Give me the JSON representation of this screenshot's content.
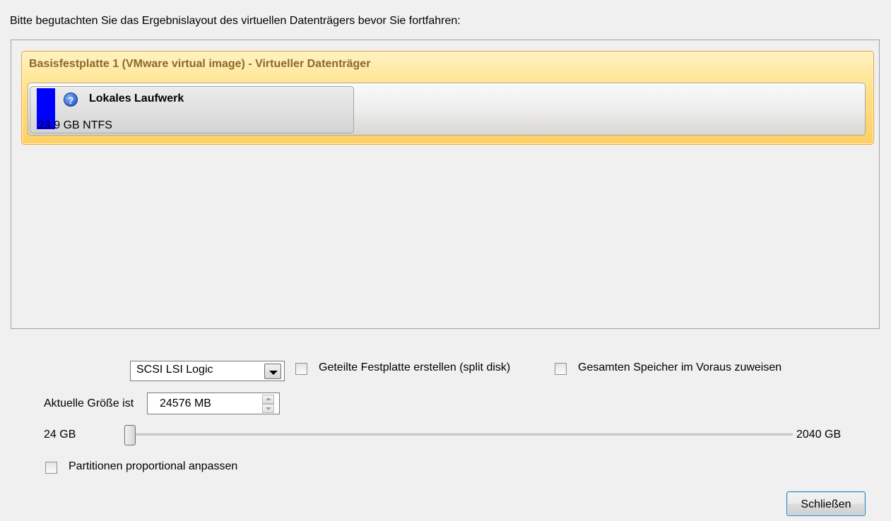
{
  "instruction": "Bitte begutachten Sie das Ergebnislayout des virtuellen Datenträgers bevor Sie fortfahren:",
  "disk": {
    "title": "Basisfestplatte 1 (VMware virtual image) - Virtueller Datenträger",
    "partition": {
      "name": "Lokales Laufwerk",
      "size": "23.9 GB NTFS",
      "color": "#0000ff",
      "icon": "help-icon",
      "icon_glyph": "?"
    }
  },
  "controls": {
    "controller": {
      "selected": "SCSI LSI Logic"
    },
    "split_disk": {
      "label": "Geteilte Festplatte erstellen (split disk)",
      "checked": false
    },
    "preallocate": {
      "label": "Gesamten Speicher im Voraus zuweisen",
      "checked": false
    },
    "size": {
      "label": "Aktuelle Größe ist",
      "value": "24576 MB"
    },
    "slider": {
      "min_label": "24 GB",
      "max_label": "2040 GB",
      "position_fraction": 0.0
    },
    "proportional": {
      "label": "Partitionen proportional anpassen",
      "checked": false
    }
  },
  "buttons": {
    "close": "Schließen"
  },
  "colors": {
    "accent": "#fdd063",
    "border_accent": "#e9a23b",
    "button_border": "#3c7fb1"
  }
}
